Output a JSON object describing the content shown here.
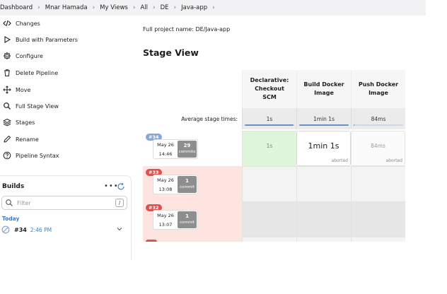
{
  "breadcrumb": [
    "Dashboard",
    "Mnar Hamada",
    "My Views",
    "All",
    "DE",
    "Java-app"
  ],
  "sidebar": {
    "items": [
      {
        "label": "Changes",
        "icon": "code-icon"
      },
      {
        "label": "Build with Parameters",
        "icon": "play-icon"
      },
      {
        "label": "Configure",
        "icon": "gear-icon"
      },
      {
        "label": "Delete Pipeline",
        "icon": "trash-icon"
      },
      {
        "label": "Move",
        "icon": "move-icon"
      },
      {
        "label": "Full Stage View",
        "icon": "search-icon"
      },
      {
        "label": "Stages",
        "icon": "layers-icon"
      },
      {
        "label": "Rename",
        "icon": "pencil-icon"
      },
      {
        "label": "Pipeline Syntax",
        "icon": "help-icon"
      }
    ]
  },
  "builds": {
    "title": "Builds",
    "filter_placeholder": "Filter",
    "filter_shortcut": "/",
    "group": "Today",
    "rows": [
      {
        "number": "#34",
        "time": "2:46 PM"
      }
    ]
  },
  "main": {
    "full_name": "Full project name: DE/Java-app",
    "stage_title": "Stage View",
    "avg_label": "Average stage times:",
    "columns": [
      {
        "title": "Declarative: Checkout SCM",
        "avg": "1s",
        "bar": 0.98
      },
      {
        "title": "Build Docker Image",
        "avg": "1min 1s",
        "bar": 1.0
      },
      {
        "title": "Push Docker Image",
        "avg": "84ms",
        "bar": 0.02
      }
    ],
    "rows": [
      {
        "badge": "#34",
        "date": "May 26",
        "time": "14:46",
        "commits": "29",
        "commit_label": "commits",
        "cells": [
          {
            "value": "1s"
          },
          {
            "value": "1min 1s",
            "tag": "aborted"
          },
          {
            "value": "84ms",
            "tag": "aborted"
          }
        ]
      },
      {
        "badge": "#33",
        "date": "May 26",
        "time": "13:08",
        "commits": "1",
        "commit_label": "commit",
        "cells": []
      },
      {
        "badge": "#32",
        "date": "May 26",
        "time": "13:07",
        "commits": "1",
        "commit_label": "commit",
        "cells": []
      }
    ]
  },
  "colors": {
    "success": "#dff5dc",
    "failed_row": "#fde4e1",
    "badge_success": "#8aa6d6",
    "badge_failed": "#d9534f",
    "accent": "#3a7bd5"
  }
}
